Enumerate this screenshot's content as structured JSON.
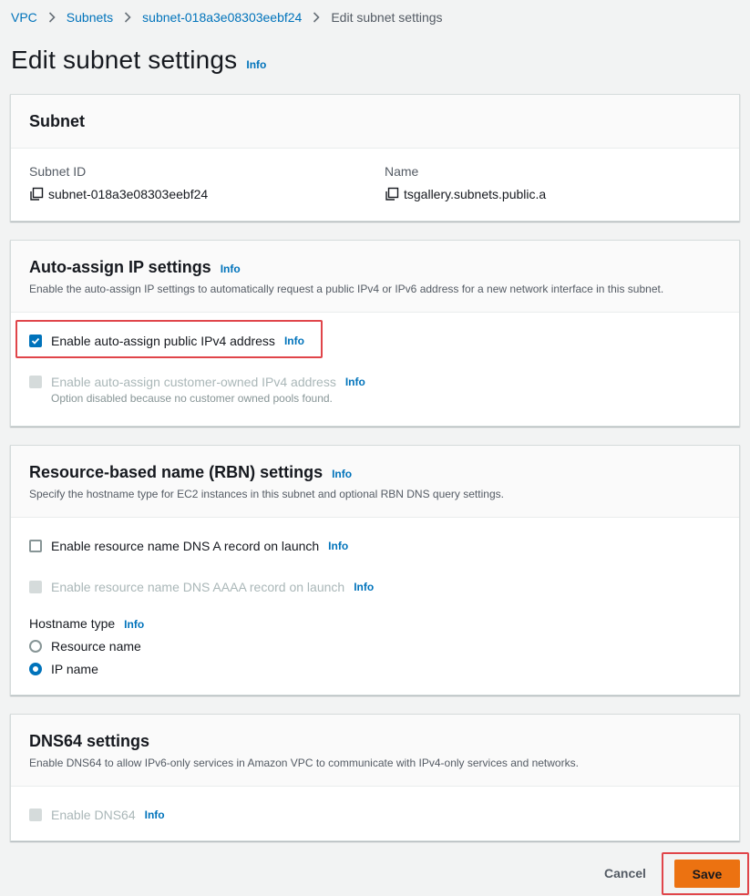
{
  "breadcrumb": {
    "items": [
      "VPC",
      "Subnets",
      "subnet-018a3e08303eebf24"
    ],
    "current": "Edit subnet settings"
  },
  "page": {
    "title": "Edit subnet settings",
    "info": "Info"
  },
  "subnet_panel": {
    "title": "Subnet",
    "subnet_id_label": "Subnet ID",
    "subnet_id_value": "subnet-018a3e08303eebf24",
    "name_label": "Name",
    "name_value": "tsgallery.subnets.public.a"
  },
  "auto_assign": {
    "title": "Auto-assign IP settings",
    "info": "Info",
    "description": "Enable the auto-assign IP settings to automatically request a public IPv4 or IPv6 address for a new network interface in this subnet.",
    "ipv4_label": "Enable auto-assign public IPv4 address",
    "ipv4_checked": true,
    "customer_owned_label": "Enable auto-assign customer-owned IPv4 address",
    "customer_owned_note": "Option disabled because no customer owned pools found."
  },
  "rbn": {
    "title": "Resource-based name (RBN) settings",
    "info": "Info",
    "description": "Specify the hostname type for EC2 instances in this subnet and optional RBN DNS query settings.",
    "dns_a_label": "Enable resource name DNS A record on launch",
    "dns_aaaa_label": "Enable resource name DNS AAAA record on launch",
    "hostname_type_label": "Hostname type",
    "options": [
      "Resource name",
      "IP name"
    ],
    "selected": "IP name"
  },
  "dns64": {
    "title": "DNS64 settings",
    "description": "Enable DNS64 to allow IPv6-only services in Amazon VPC to communicate with IPv4-only services and networks.",
    "enable_label": "Enable DNS64",
    "info": "Info"
  },
  "footer": {
    "cancel_label": "Cancel",
    "save_label": "Save"
  },
  "colors": {
    "accent": "#0073bb",
    "primary_button": "#ec7211",
    "highlight": "#e0454a"
  }
}
